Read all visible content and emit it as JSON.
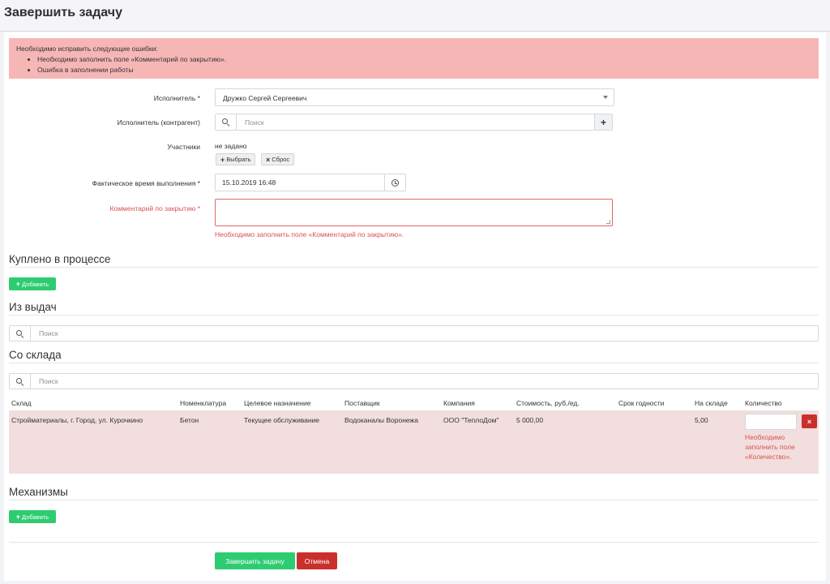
{
  "page": {
    "title": "Завершить задачу"
  },
  "alert": {
    "heading": "Необходимо исправить следующие ошибки:",
    "errors": [
      "Необходимо заполнить поле «Комментарий по закрытию».",
      "Ошибка в заполнении работы"
    ]
  },
  "form": {
    "executor": {
      "label": "Исполнитель *",
      "value": "Дружко Сергей Сергеевич"
    },
    "contractor": {
      "label": "Исполнитель (контрагент)",
      "placeholder": "Поиск",
      "add": "+"
    },
    "participants": {
      "label": "Участники",
      "value": "не задано",
      "choose": "Выбрать",
      "reset": "Сброс"
    },
    "actual_time": {
      "label": "Фактическое время выполнения *",
      "value": "15.10.2019 16:48"
    },
    "comment": {
      "label": "Комментарий по закрытию *",
      "value": "",
      "error": "Необходимо заполнить поле «Комментарий по закрытию»."
    }
  },
  "sections": {
    "bought": {
      "title": "Куплено в процессе",
      "add_label": "Добавить"
    },
    "issued": {
      "title": "Из выдач",
      "search_placeholder": "Поиск"
    },
    "warehouse": {
      "title": "Со склада",
      "search_placeholder": "Поиск"
    },
    "mechanisms": {
      "title": "Механизмы",
      "add_label": "Добавить"
    }
  },
  "table": {
    "headers": [
      "Склад",
      "Номенклатура",
      "Целевое назначение",
      "Поставщик",
      "Компания",
      "Стоимость, руб./ед.",
      "Срок годности",
      "На складе",
      "Количество"
    ],
    "row": {
      "warehouse": "Стройматериалы, г. Город, ул. Курочкино",
      "item": "Бетон",
      "purpose": "Текущее обслуживание",
      "supplier": "Водоканалы Воронежа",
      "company": "ООО \"ТеплоДом\"",
      "price": "5 000,00",
      "expiry": "",
      "in_stock": "5,00",
      "quantity": "",
      "quantity_error": "Необходимо заполнить поле «Количество».",
      "delete": "×"
    }
  },
  "actions": {
    "submit": "Завершить задачу",
    "cancel": "Отмена"
  },
  "colors": {
    "success": "#2ecc71",
    "danger": "#c9302c",
    "alert_bg": "#f7b6b6",
    "error_text": "#d9534f"
  }
}
